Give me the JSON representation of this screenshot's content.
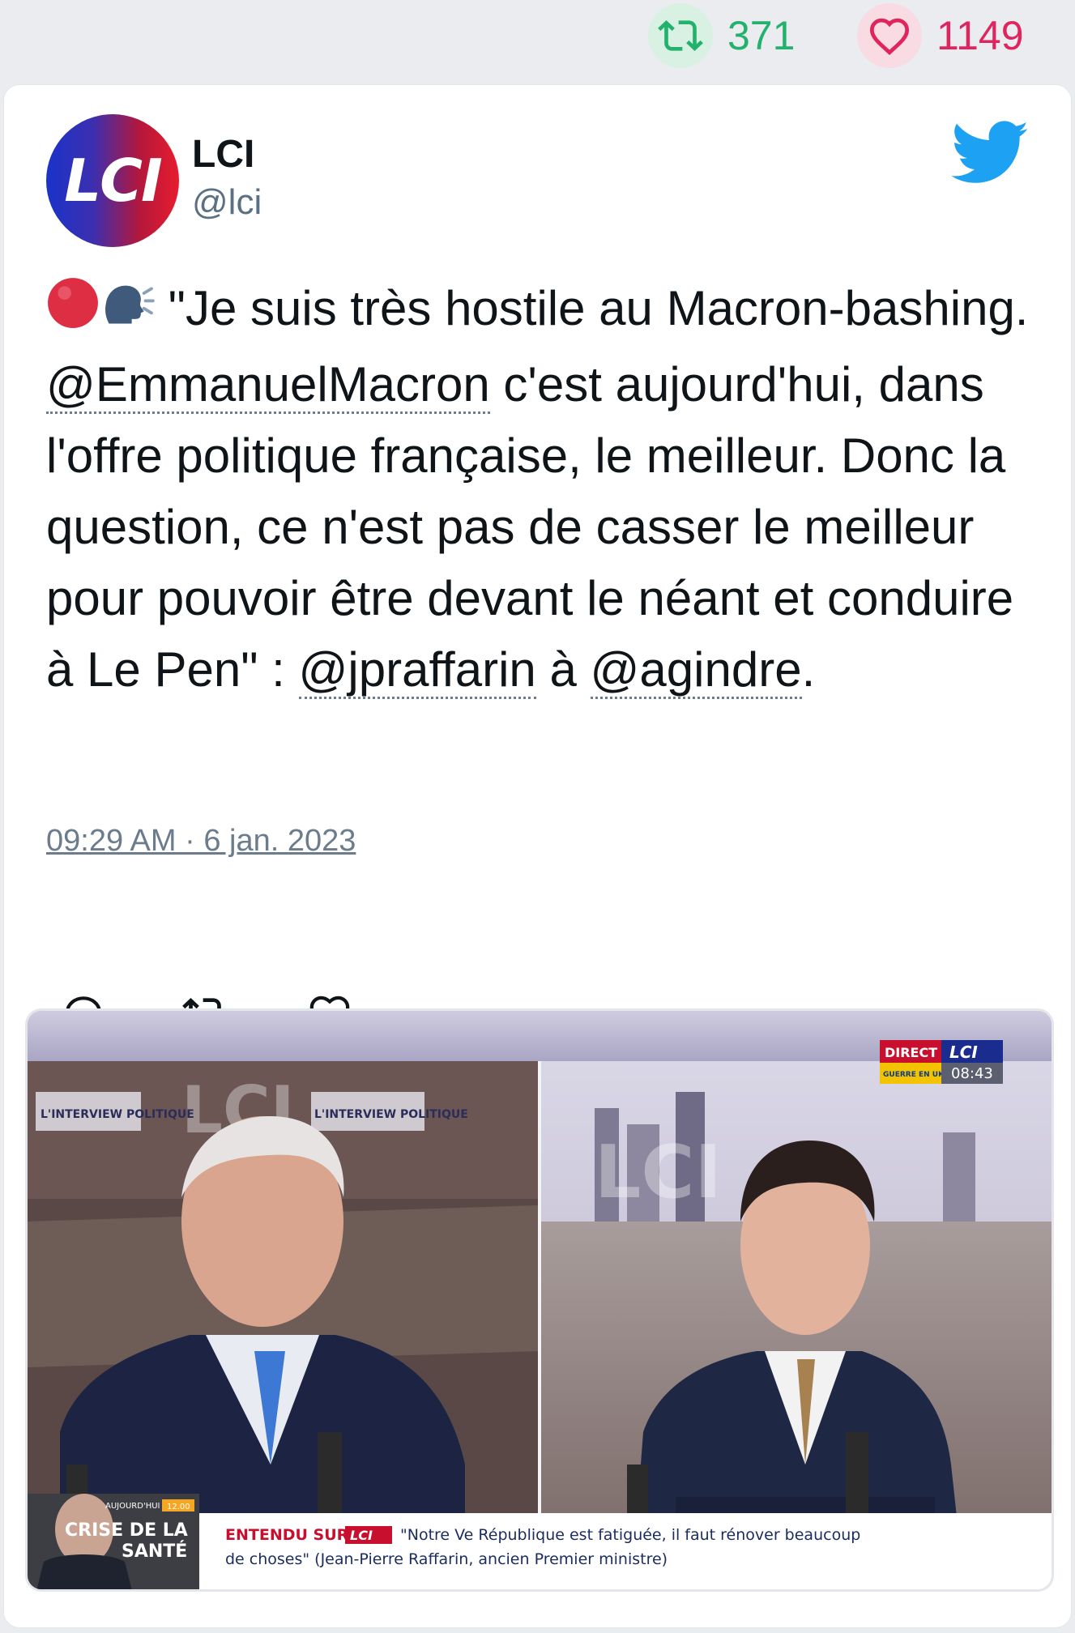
{
  "stats": {
    "retweets": "371",
    "likes": "1149"
  },
  "author": {
    "avatar_text": "LCI",
    "name": "LCI",
    "handle": "@lci"
  },
  "tweet": {
    "part1": " \"Je suis très hostile au Macron-bashing. ",
    "mention1": "@EmmanuelMacron",
    "part2": " c'est aujourd'hui, dans l'offre politique française, le meilleur. Donc la question, ce n'est pas de casser le meilleur pour pouvoir être devant le néant et conduire à Le Pen\" : ",
    "mention2": "@jpraffarin",
    "part3": " à ",
    "mention3": "@agindre",
    "part4": ".",
    "timestamp": "09:29 AM · 6 jan. 2023"
  },
  "media": {
    "left_bg_text": "LCI",
    "right_bg_text": "LCI",
    "sign1": "L'INTERVIEW POLITIQUE",
    "sign2": "L'INTERVIEW POLITIQUE",
    "direct": "DIRECT",
    "logo": "LCI",
    "guerre": "GUERRE EN UKRAINE",
    "time": "08:43",
    "inset_small": "AUJOURD'HUI",
    "inset_time": "12.00",
    "inset_crise1": "CRISE DE LA",
    "inset_crise2": "SANTÉ",
    "entendu": "ENTENDU SUR",
    "entendu_logo": "LCI",
    "quote_line1": "\"Notre Ve République est fatiguée, il faut rénover beaucoup",
    "quote_line2": "de choses\" (Jean-Pierre Raffarin, ancien Premier ministre)"
  },
  "colors": {
    "retweet": "#23b26d",
    "like": "#e0245e",
    "twitter_blue": "#1da1f2"
  },
  "icons": [
    "retweet-icon",
    "heart-icon",
    "twitter-bird-icon",
    "red-circle-emoji",
    "speaking-head-emoji",
    "reply-icon"
  ]
}
